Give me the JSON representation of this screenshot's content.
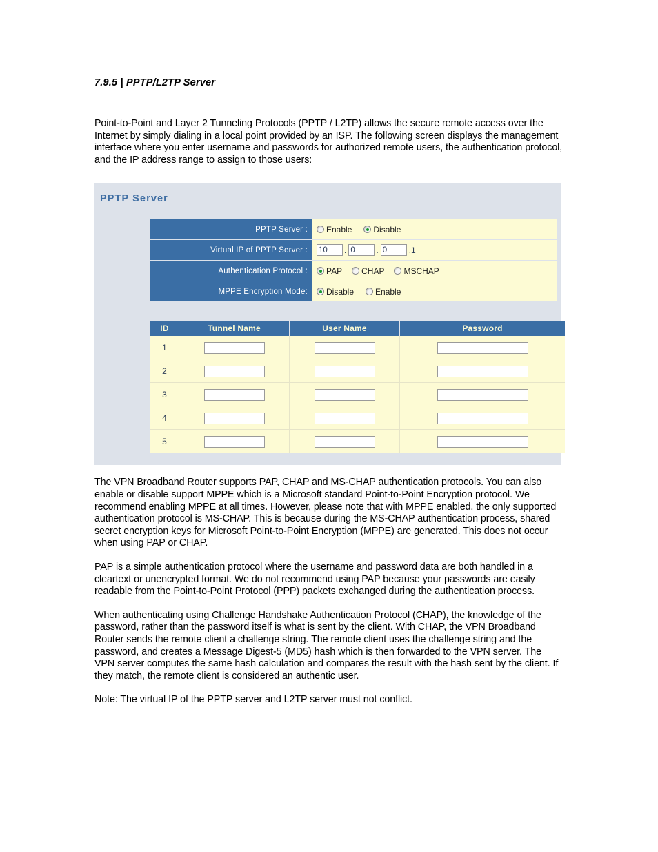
{
  "document": {
    "heading": "7.9.5 | PPTP/L2TP Server",
    "intro_paragraph": "Point-to-Point and Layer 2 Tunneling Protocols (PPTP / L2TP) allows the secure remote access over the Internet by simply dialing in a local point provided by an ISP. The following screen displays the management interface where you enter username and passwords for authorized remote users, the authentication protocol, and the IP address range to assign to those users:",
    "paragraph_2": "The VPN Broadband Router supports PAP, CHAP and MS-CHAP authentication protocols. You can also enable or disable support MPPE which is a Microsoft standard Point-to-Point Encryption protocol. We recommend enabling MPPE at all times. However, please note that with MPPE enabled, the only supported authentication protocol is MS-CHAP. This is because during the MS-CHAP authentication process, shared secret encryption keys for Microsoft Point-to-Point Encryption (MPPE) are generated. This does not occur when using PAP or CHAP.",
    "paragraph_3": "PAP is a simple authentication protocol where the username and password data are both handled in a cleartext or unencrypted format. We do not recommend using PAP because your passwords are easily readable from the Point-to-Point Protocol (PPP) packets exchanged during the authentication process.",
    "paragraph_4": "When authenticating using Challenge Handshake Authentication Protocol (CHAP), the knowledge of the password, rather than the password itself is what is sent by the client. With CHAP, the VPN Broadband Router sends the remote client a challenge string. The remote client uses the challenge string and the password, and creates a Message Digest-5 (MD5) hash which is then forwarded to the VPN server. The VPN server computes the same hash calculation and compares the result with the hash sent by the client. If they match, the remote client is considered an authentic user.",
    "paragraph_5": "Note: The virtual IP of the PPTP server and L2TP server must not conflict."
  },
  "panel": {
    "title": "PPTP Server",
    "colors": {
      "panel_background": "#dde2ea",
      "title_text": "#3f6ea3",
      "label_background": "#3a6ea5",
      "value_background": "#fdfbd4",
      "header_text": "#fdfbd4",
      "radio_selected_dot": "#1a9a2e"
    },
    "form": {
      "rows": [
        {
          "label": "PPTP Server :",
          "type": "radio",
          "options": [
            {
              "label": "Enable",
              "selected": false
            },
            {
              "label": "Disable",
              "selected": true
            }
          ]
        },
        {
          "label": "Virtual IP of PPTP Server :",
          "type": "ip",
          "octets": [
            "10",
            "0",
            "0"
          ],
          "separator": ".",
          "suffix": ".1"
        },
        {
          "label": "Authentication Protocol :",
          "type": "radio",
          "options": [
            {
              "label": "PAP",
              "selected": true
            },
            {
              "label": "CHAP",
              "selected": false
            },
            {
              "label": "MSCHAP",
              "selected": false
            }
          ]
        },
        {
          "label": "MPPE Encryption Mode:",
          "type": "radio",
          "options": [
            {
              "label": "Disable",
              "selected": true
            },
            {
              "label": "Enable",
              "selected": false
            }
          ]
        }
      ]
    },
    "users_table": {
      "columns": [
        "ID",
        "Tunnel Name",
        "User Name",
        "Password"
      ],
      "rows": [
        {
          "id": "1",
          "tunnel_name": "",
          "user_name": "",
          "password": ""
        },
        {
          "id": "2",
          "tunnel_name": "",
          "user_name": "",
          "password": ""
        },
        {
          "id": "3",
          "tunnel_name": "",
          "user_name": "",
          "password": ""
        },
        {
          "id": "4",
          "tunnel_name": "",
          "user_name": "",
          "password": ""
        },
        {
          "id": "5",
          "tunnel_name": "",
          "user_name": "",
          "password": ""
        }
      ]
    }
  }
}
